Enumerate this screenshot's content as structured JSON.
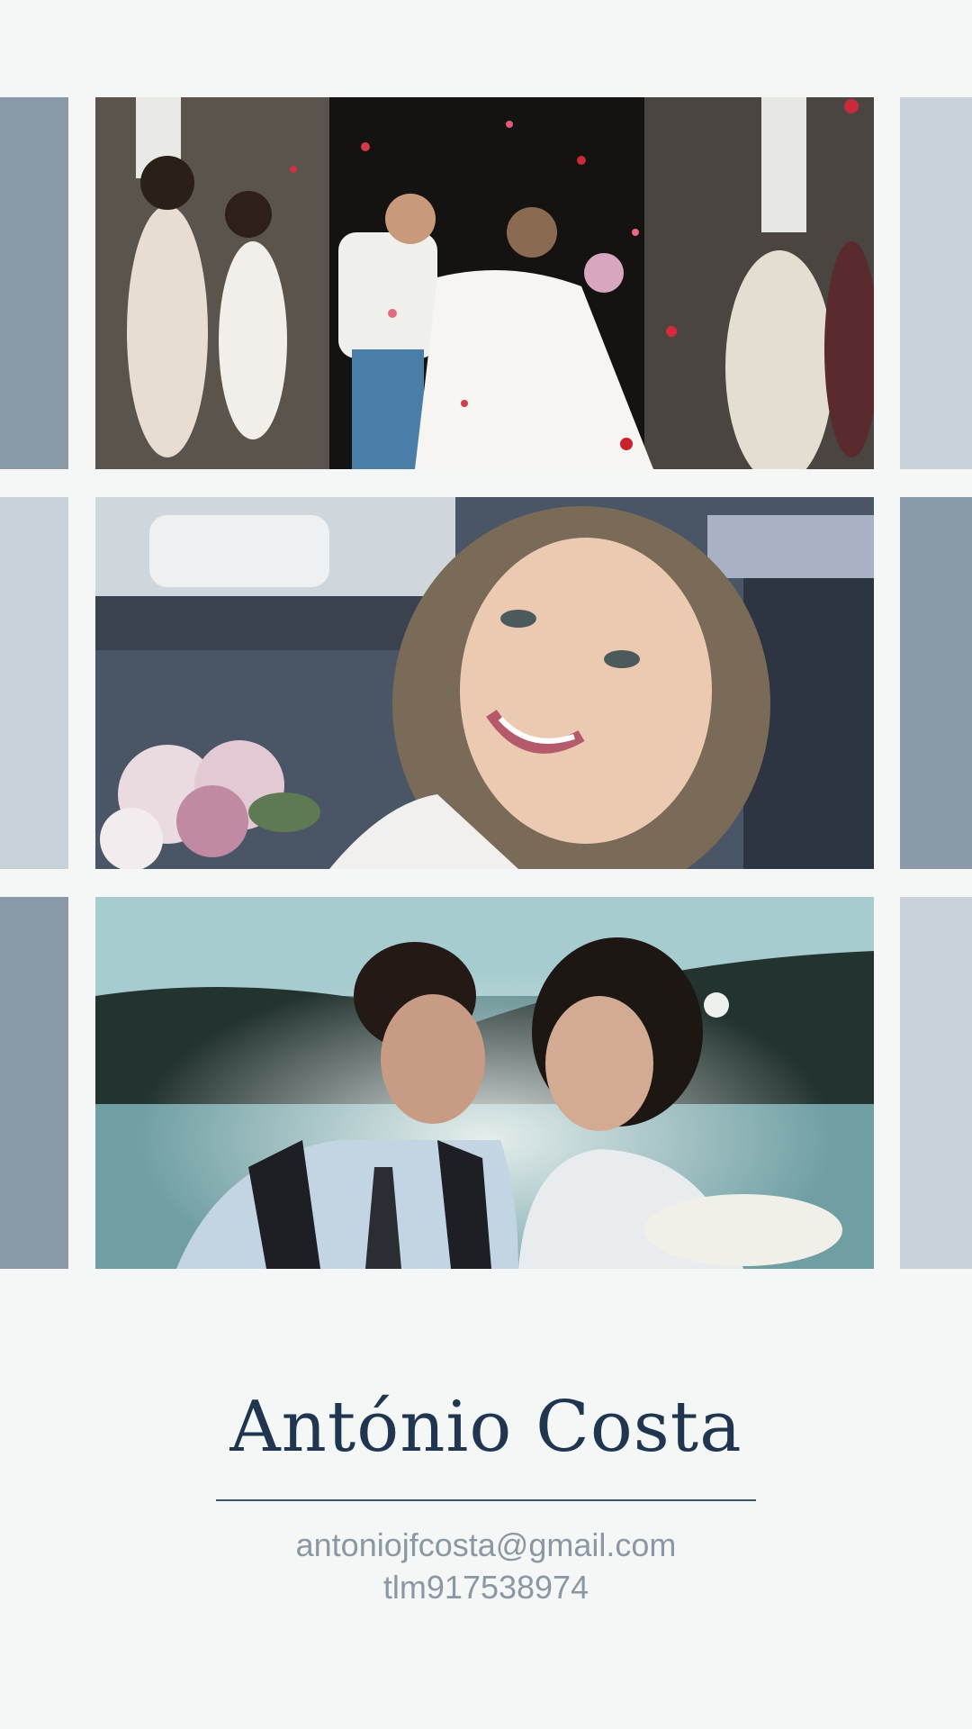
{
  "gallery": {
    "photos": [
      {
        "subject": "wedding couple leaving church under falling petals"
      },
      {
        "subject": "smiling bride in car holding pink bouquet"
      },
      {
        "subject": "bride and groom facing each other by a lake"
      }
    ]
  },
  "card": {
    "name": "António Costa",
    "email": "antoniojfcosta@gmail.com",
    "phone": "tlm917538974"
  },
  "colors": {
    "background": "#f4f7f6",
    "name_text": "#1f3550",
    "contact_text": "#8b97a3",
    "side_panel_dark": "#8a9aa8",
    "side_panel_light": "#c9d1d9"
  }
}
